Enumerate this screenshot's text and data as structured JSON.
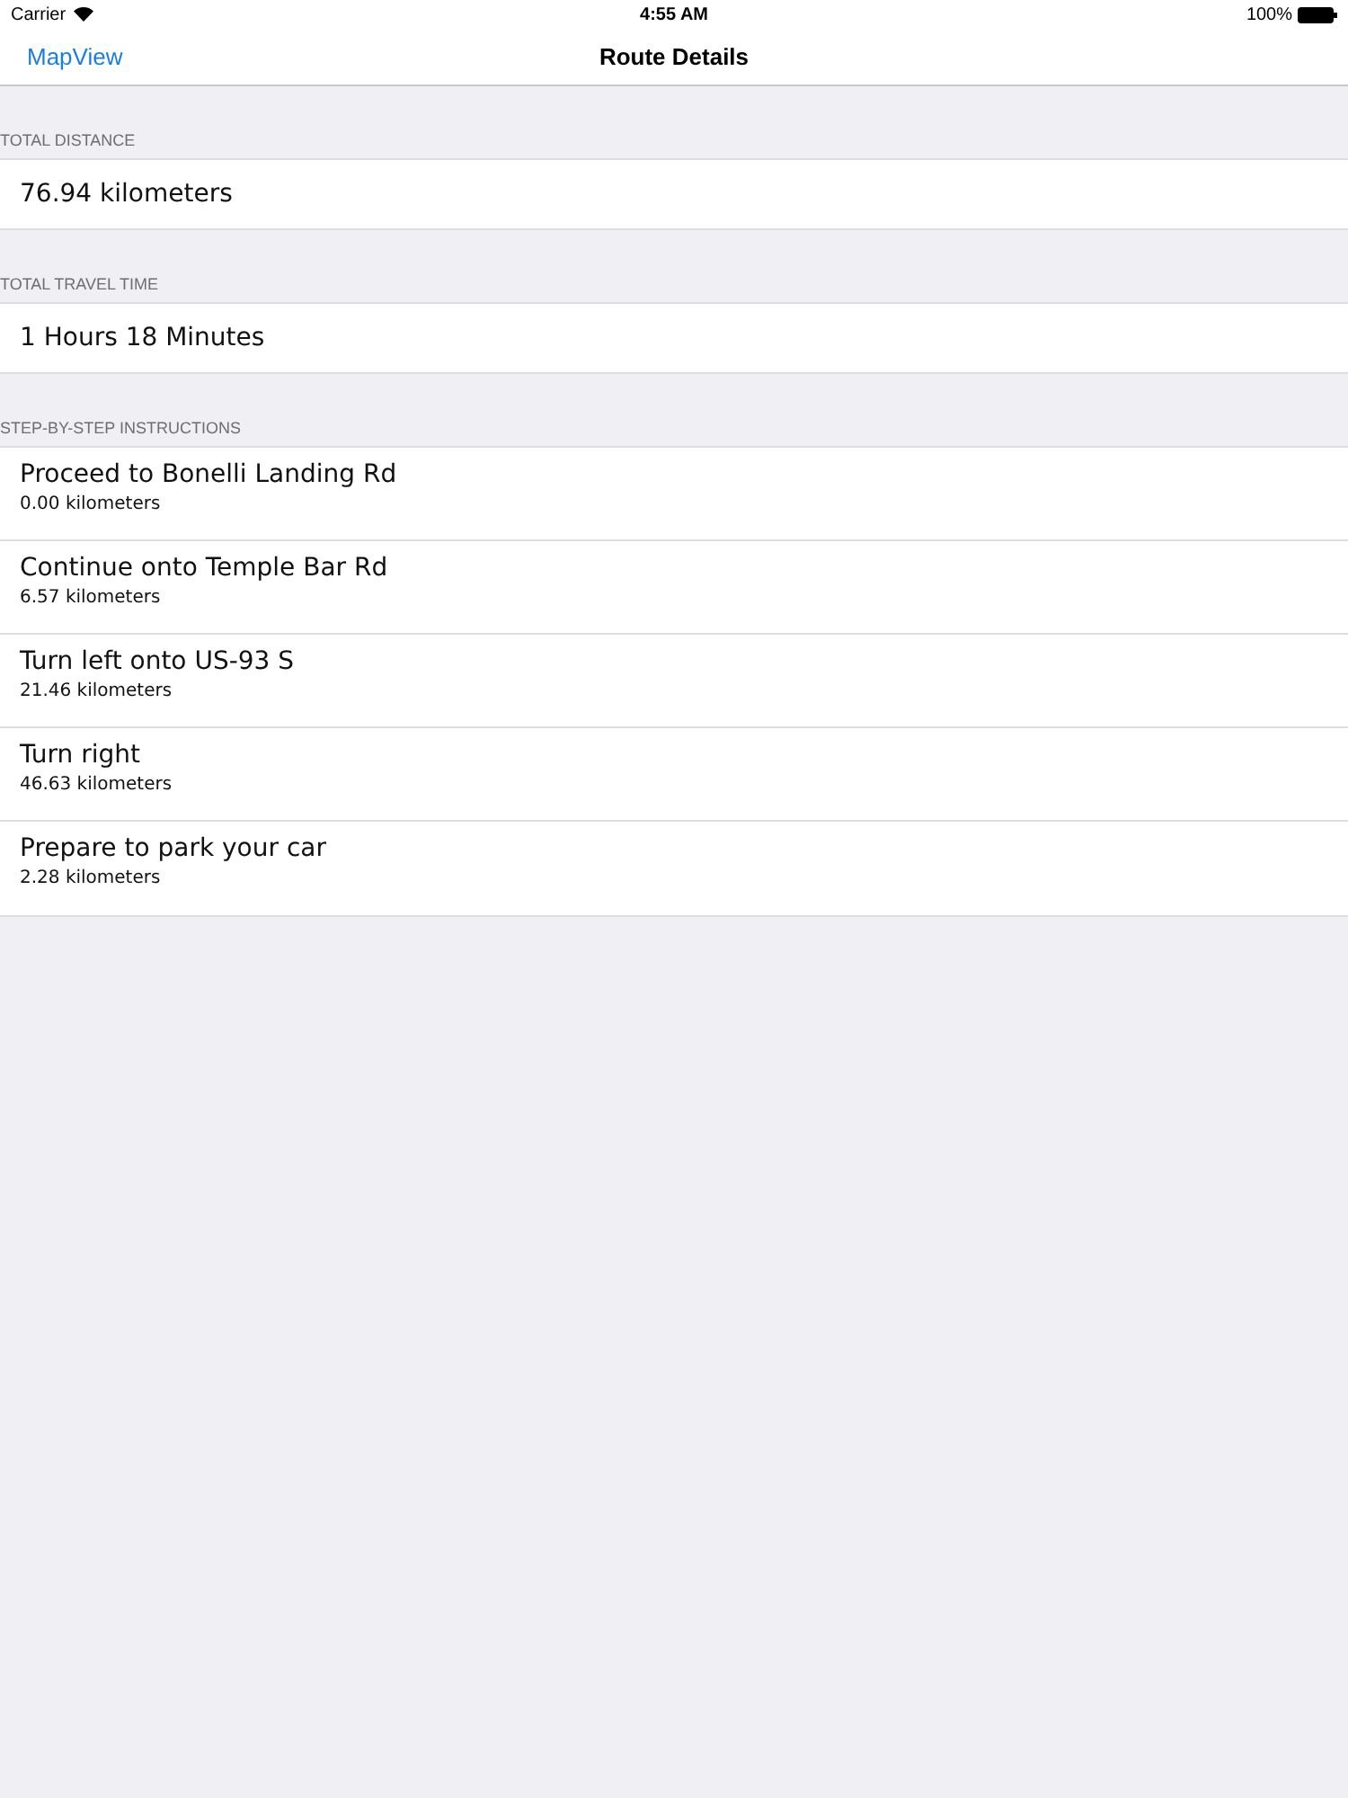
{
  "status_bar": {
    "carrier": "Carrier",
    "time": "4:55 AM",
    "battery": "100%"
  },
  "nav_bar": {
    "back": "MapView",
    "title": "Route Details"
  },
  "sections": [
    {
      "kind": "value",
      "header": "TOTAL DISTANCE",
      "value": "76.94 kilometers"
    },
    {
      "kind": "value",
      "header": "TOTAL TRAVEL TIME",
      "value": "1 Hours 18 Minutes"
    },
    {
      "kind": "steps",
      "header": "STEP-BY-STEP INSTRUCTIONS",
      "steps": [
        {
          "instruction": "Proceed to Bonelli Landing Rd",
          "distance": "0.00 kilometers"
        },
        {
          "instruction": "Continue onto Temple Bar Rd",
          "distance": "6.57 kilometers"
        },
        {
          "instruction": "Turn left onto US-93 S",
          "distance": "21.46 kilometers"
        },
        {
          "instruction": "Turn right",
          "distance": "46.63 kilometers"
        },
        {
          "instruction": "Prepare to park your car",
          "distance": "2.28 kilometers"
        }
      ]
    }
  ]
}
